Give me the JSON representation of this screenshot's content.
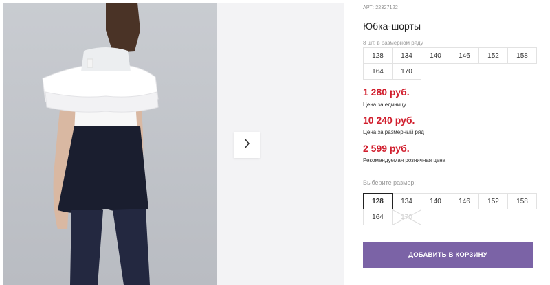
{
  "product": {
    "article": "АРТ: 22327122",
    "title": "Юбка-шорты",
    "pack_note": "8 шт. в размерном ряду"
  },
  "size_range": [
    "128",
    "134",
    "140",
    "146",
    "152",
    "158",
    "164",
    "170"
  ],
  "prices": {
    "unit_price": "1 280 руб.",
    "unit_label": "Цена за единицу",
    "range_price": "10 240 руб.",
    "range_label": "Цена за размерный ряд",
    "retail_price": "2 599 руб.",
    "retail_label": "Рекомендуемая розничная цена"
  },
  "size_picker": {
    "label": "Выберите размер:",
    "options": [
      {
        "label": "128",
        "state": "selected"
      },
      {
        "label": "134",
        "state": "available"
      },
      {
        "label": "140",
        "state": "available"
      },
      {
        "label": "146",
        "state": "available"
      },
      {
        "label": "152",
        "state": "available"
      },
      {
        "label": "158",
        "state": "available"
      },
      {
        "label": "164",
        "state": "available"
      },
      {
        "label": "170",
        "state": "unavailable"
      }
    ]
  },
  "cart": {
    "add_label": "ДОБАВИТЬ В КОРЗИНУ"
  },
  "colors": {
    "price": "#d11f2e",
    "button": "#7b63a6",
    "photo_bg": "#c3c6cb"
  },
  "icons": {
    "next": "chevron-right-icon"
  }
}
